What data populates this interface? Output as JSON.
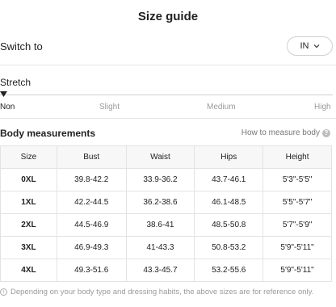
{
  "header": {
    "title": "Size guide"
  },
  "switch": {
    "label": "Switch to",
    "unit": "IN"
  },
  "stretch": {
    "label": "Stretch",
    "levels": [
      "Non",
      "Slight",
      "Medium",
      "High"
    ],
    "selected": "Non"
  },
  "measurements": {
    "title": "Body measurements",
    "help_link": "How to measure body",
    "columns": [
      "Size",
      "Bust",
      "Waist",
      "Hips",
      "Height"
    ],
    "rows": [
      [
        "0XL",
        "39.8-42.2",
        "33.9-36.2",
        "43.7-46.1",
        "5'3\"-5'5\""
      ],
      [
        "1XL",
        "42.2-44.5",
        "36.2-38.6",
        "46.1-48.5",
        "5'5\"-5'7\""
      ],
      [
        "2XL",
        "44.5-46.9",
        "38.6-41",
        "48.5-50.8",
        "5'7\"-5'9\""
      ],
      [
        "3XL",
        "46.9-49.3",
        "41-43.3",
        "50.8-53.2",
        "5'9\"-5'11\""
      ],
      [
        "4XL",
        "49.3-51.6",
        "43.3-45.7",
        "53.2-55.6",
        "5'9\"-5'11\""
      ]
    ]
  },
  "footnote": "Depending on your body type and dressing habits, the above sizes are for reference only.",
  "colors": {
    "text": "#222222",
    "muted": "#9a9a9a",
    "border": "#e3e3e3",
    "header_bg": "#f7f7f7"
  },
  "icons": {
    "unit_dropdown": "chevron-down-icon",
    "help": "question-icon",
    "info": "info-icon",
    "stretch_marker": "triangle-marker-icon"
  }
}
